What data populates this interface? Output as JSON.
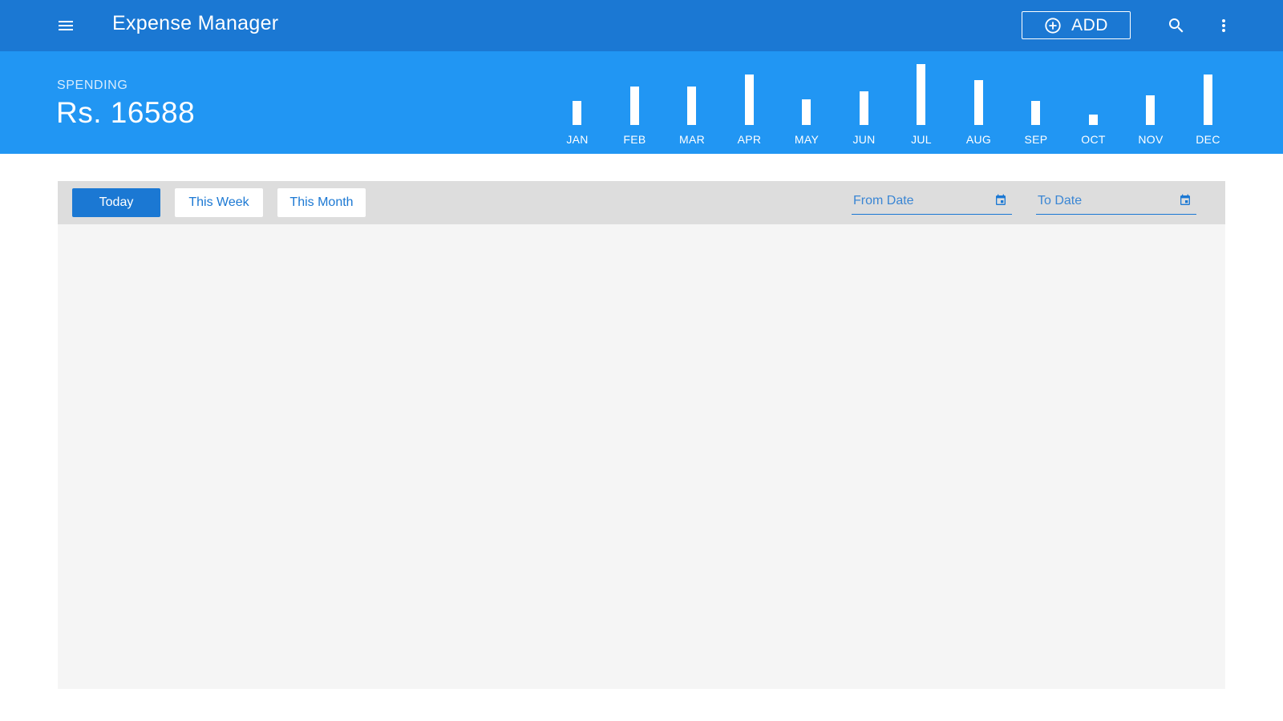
{
  "appbar": {
    "title": "Expense Manager",
    "add_label": "ADD",
    "icons": {
      "menu": "menu-icon",
      "add": "add-circle-icon",
      "search": "search-icon",
      "more": "more-vert-icon"
    }
  },
  "summary": {
    "label": "SPENDING",
    "amount": "Rs. 16588"
  },
  "chart_data": {
    "type": "bar",
    "categories": [
      "JAN",
      "FEB",
      "MAR",
      "APR",
      "MAY",
      "JUN",
      "JUL",
      "AUG",
      "SEP",
      "OCT",
      "NOV",
      "DEC"
    ],
    "values": [
      30,
      48,
      48,
      63,
      32,
      42,
      76,
      56,
      30,
      13,
      37,
      63
    ],
    "ylim": [
      0,
      76
    ],
    "grid": false,
    "title": "",
    "xlabel": "",
    "ylabel": ""
  },
  "filters": {
    "tabs": [
      {
        "label": "Today",
        "active": true
      },
      {
        "label": "This Week",
        "active": false
      },
      {
        "label": "This Month",
        "active": false
      }
    ],
    "from_date": {
      "placeholder": "From Date",
      "value": ""
    },
    "to_date": {
      "placeholder": "To Date",
      "value": ""
    }
  },
  "colors": {
    "appbar": "#1b78d3",
    "summary": "#2196f3",
    "filter_bar": "#dddddd",
    "list_bg": "#f5f5f5"
  }
}
